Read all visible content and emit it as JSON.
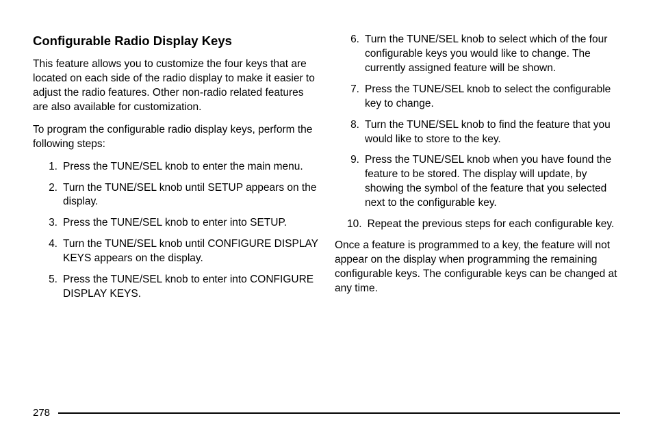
{
  "heading": "Configurable Radio Display Keys",
  "para1": "This feature allows you to customize the four keys that are located on each side of the radio display to make it easier to adjust the radio features. Other non-radio related features are also available for customization.",
  "para2": "To program the configurable radio display keys, perform the following steps:",
  "steps": [
    "Press the TUNE/SEL knob to enter the main menu.",
    "Turn the TUNE/SEL knob until SETUP appears on the display.",
    "Press the TUNE/SEL knob to enter into SETUP.",
    "Turn the TUNE/SEL knob until CONFIGURE DISPLAY KEYS appears on the display.",
    "Press the TUNE/SEL knob to enter into CONFIGURE DISPLAY KEYS.",
    "Turn the TUNE/SEL knob to select which of the four configurable keys you would like to change. The currently assigned feature will be shown.",
    "Press the TUNE/SEL knob to select the configurable key to change.",
    "Turn the TUNE/SEL knob to find the feature that you would like to store to the key.",
    "Press the TUNE/SEL knob when you have found the feature to be stored. The display will update, by showing the symbol of the feature that you selected next to the configurable key.",
    "Repeat the previous steps for each configurable key."
  ],
  "closing": "Once a feature is programmed to a key, the feature will not appear on the display when programming the remaining configurable keys. The configurable keys can be changed at any time.",
  "pageNumber": "278"
}
